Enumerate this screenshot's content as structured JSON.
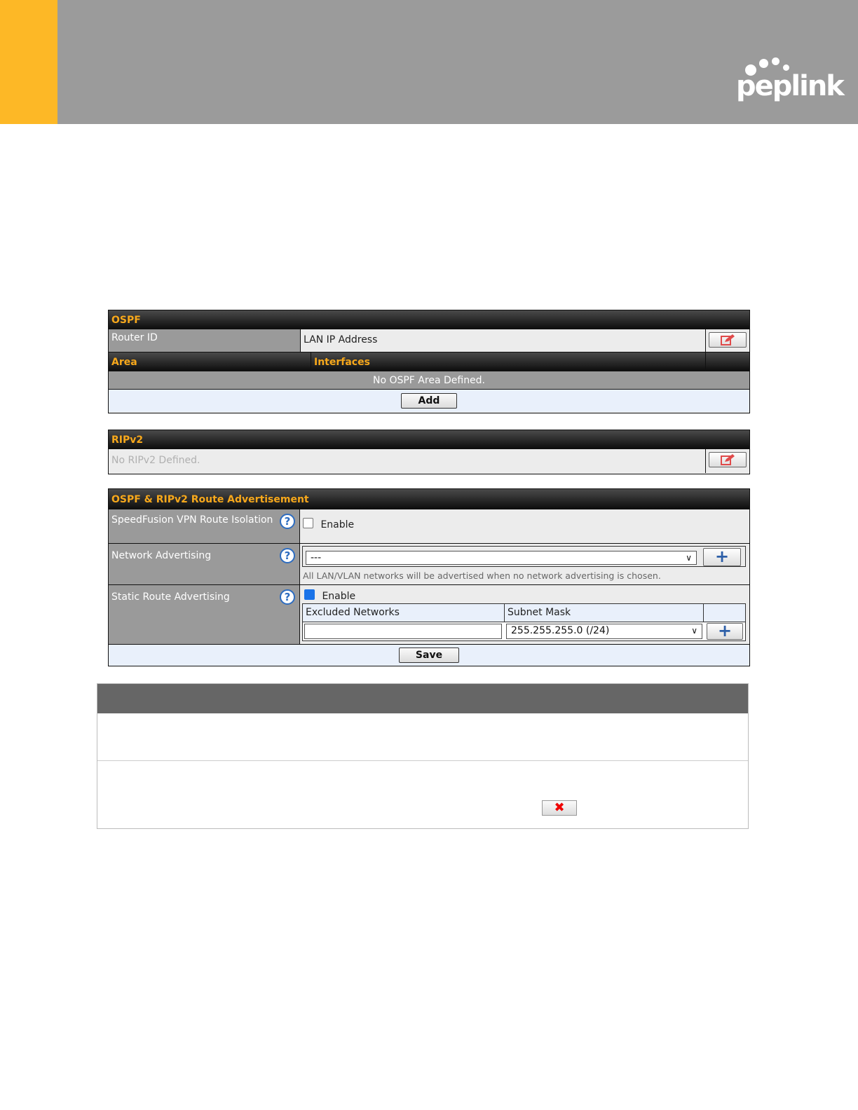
{
  "brand": {
    "logo_text": "peplink",
    "accent_color": "#fdb826",
    "header_color": "#9b9b9b"
  },
  "ospf": {
    "title": "OSPF",
    "router_id_label": "Router ID",
    "router_id_value": "LAN IP Address",
    "area_header": "Area",
    "interfaces_header": "Interfaces",
    "empty_message": "No OSPF Area Defined.",
    "add_label": "Add"
  },
  "ripv2": {
    "title": "RIPv2",
    "empty_message": "No RIPv2 Defined."
  },
  "advert": {
    "title": "OSPF & RIPv2 Route Advertisement",
    "vpn_isolation_label": "SpeedFusion VPN Route Isolation",
    "vpn_isolation_enable": "Enable",
    "network_adv_label": "Network Advertising",
    "network_adv_selected": "---",
    "network_adv_note": "All LAN/VLAN networks will be advertised when no network advertising is chosen.",
    "static_route_label": "Static Route Advertising",
    "static_route_enable": "Enable",
    "excluded_networks_header": "Excluded Networks",
    "subnet_mask_header": "Subnet Mask",
    "subnet_mask_selected": "255.255.255.0 (/24)",
    "save_label": "Save"
  },
  "icons": {
    "edit": "edit-icon",
    "help": "help-icon",
    "plus": "plus-icon",
    "delete": "delete-icon"
  }
}
